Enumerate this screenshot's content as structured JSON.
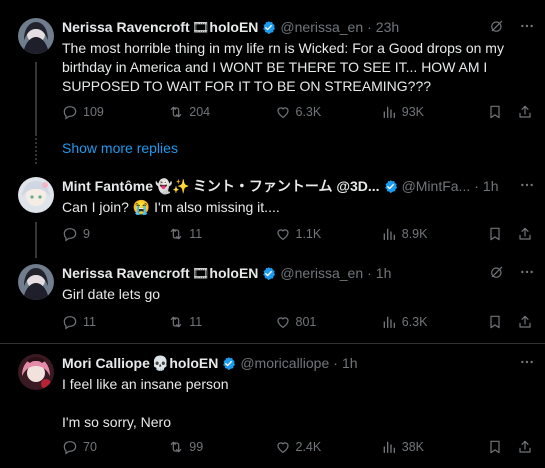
{
  "posts": [
    {
      "name": "Nerissa Ravencroft",
      "badge": "🎞",
      "org": "holoEN",
      "handle": "@nerissa_en",
      "sep": "·",
      "time": "23h",
      "text": "The most horrible thing in my life rn is Wicked: For a Good drops on my birthday in America and I WONT BE THERE TO SEE IT... HOW AM I SUPPOSED TO WAIT FOR IT TO BE ON STREAMING???",
      "replies": "109",
      "reposts": "204",
      "likes": "6.3K",
      "views": "93K"
    },
    {
      "name": "Mint Fantôme",
      "badge": "👻✨",
      "org": "ミント・ファントーム @3D...",
      "handle": "@MintFa...",
      "sep": "·",
      "time": "1h",
      "text": "Can I join? 😭 I'm also missing it....",
      "replies": "9",
      "reposts": "11",
      "likes": "1.1K",
      "views": "8.9K"
    },
    {
      "name": "Nerissa Ravencroft",
      "badge": "🎞",
      "org": "holoEN",
      "handle": "@nerissa_en",
      "sep": "·",
      "time": "1h",
      "text": "Girl date lets go",
      "replies": "11",
      "reposts": "11",
      "likes": "801",
      "views": "6.3K"
    },
    {
      "name": "Mori Calliope",
      "badge": "💀",
      "org": "holoEN",
      "handle": "@moricalliope",
      "sep": "·",
      "time": "1h",
      "text_line1": "I feel like an insane person",
      "text_line2": "I'm so sorry, Nero",
      "replies": "70",
      "reposts": "99",
      "likes": "2.4K",
      "views": "38K"
    }
  ],
  "show_more_replies": "Show more replies",
  "colors": {
    "accent": "#1d9bf0",
    "muted": "#71767b",
    "text": "#e7e9ea",
    "background": "#000000"
  }
}
